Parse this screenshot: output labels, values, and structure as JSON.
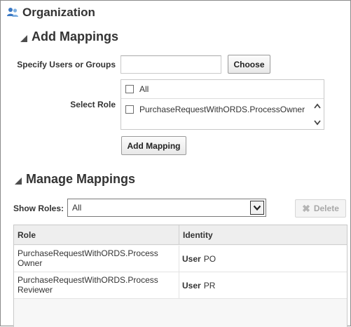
{
  "page": {
    "title": "Organization",
    "title_icon": "users-icon"
  },
  "add_mappings": {
    "header": "Add Mappings",
    "users_label": "Specify Users or Groups",
    "users_value": "",
    "choose_label": "Choose",
    "role_label": "Select Role",
    "role_all_label": "All",
    "role_all_checked": false,
    "role_options": [
      {
        "label": "PurchaseRequestWithORDS.ProcessOwner",
        "checked": false
      }
    ],
    "add_mapping_label": "Add Mapping"
  },
  "manage_mappings": {
    "header": "Manage Mappings",
    "show_roles_label": "Show Roles:",
    "show_roles_value": "All",
    "delete_label": "Delete",
    "delete_enabled": false,
    "columns": [
      "Role",
      "Identity"
    ],
    "rows": [
      {
        "role_line1": "PurchaseRequestWithORDS.Process",
        "role_line2": "Owner",
        "identity_kind": "User",
        "identity_name": "PO"
      },
      {
        "role_line1": "PurchaseRequestWithORDS.Process",
        "role_line2": "Reviewer",
        "identity_kind": "User",
        "identity_name": "PR"
      }
    ]
  },
  "colors": {
    "icon_blue": "#3a78c3",
    "text": "#333333",
    "disabled_text": "#a8a8a8"
  }
}
